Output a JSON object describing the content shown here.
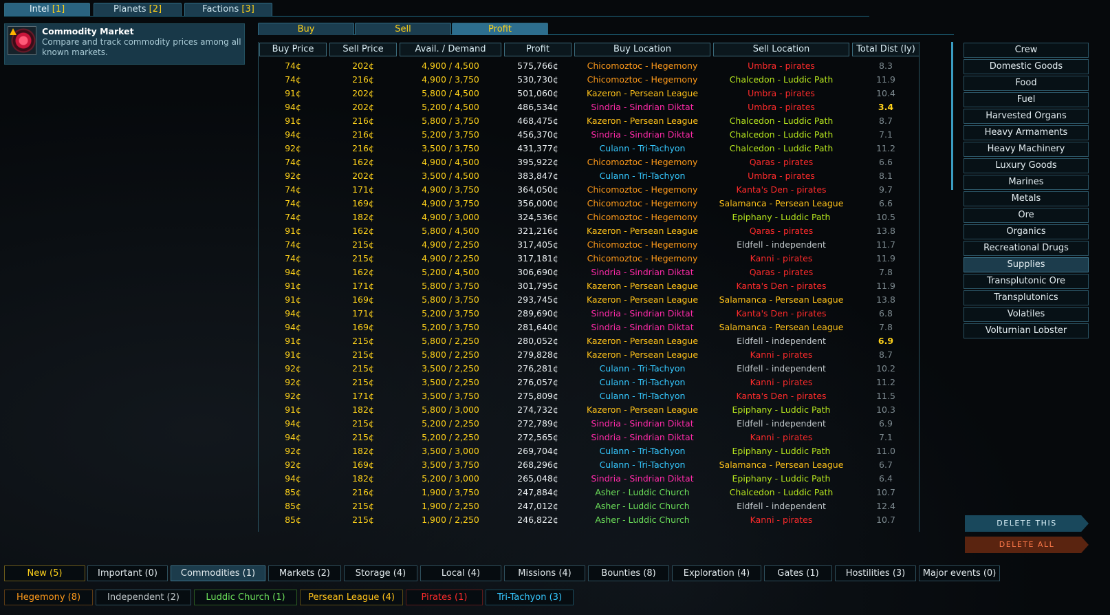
{
  "top_tabs": [
    {
      "label": "Intel",
      "count": "[1]"
    },
    {
      "label": "Planets",
      "count": "[2]"
    },
    {
      "label": "Factions",
      "count": "[3]"
    }
  ],
  "intel": {
    "title": "Commodity Market",
    "description": "Compare and track commodity prices among all known markets."
  },
  "sub_tabs": [
    "Buy",
    "Sell",
    "Profit"
  ],
  "columns": [
    "Buy Price",
    "Sell Price",
    "Avail. / Demand",
    "Profit",
    "Buy Location",
    "Sell Location",
    "Total Dist (ly)"
  ],
  "rows": [
    {
      "buy": "74¢",
      "sell": "202¢",
      "avail": "4,900 / 4,500",
      "profit": "575,766¢",
      "buy_loc": "Chicomoztoc - Hegemony",
      "buy_fac": "hegemony",
      "sell_loc": "Umbra - pirates",
      "sell_fac": "pirates",
      "dist": "8.3"
    },
    {
      "buy": "74¢",
      "sell": "216¢",
      "avail": "4,900 / 3,750",
      "profit": "530,730¢",
      "buy_loc": "Chicomoztoc - Hegemony",
      "buy_fac": "hegemony",
      "sell_loc": "Chalcedon - Luddic Path",
      "sell_fac": "luddic-path",
      "dist": "11.9"
    },
    {
      "buy": "91¢",
      "sell": "202¢",
      "avail": "5,800 / 4,500",
      "profit": "501,060¢",
      "buy_loc": "Kazeron - Persean League",
      "buy_fac": "persean",
      "sell_loc": "Umbra - pirates",
      "sell_fac": "pirates",
      "dist": "10.4"
    },
    {
      "buy": "94¢",
      "sell": "202¢",
      "avail": "5,200 / 4,500",
      "profit": "486,534¢",
      "buy_loc": "Sindria - Sindrian Diktat",
      "buy_fac": "sindrian",
      "sell_loc": "Umbra - pirates",
      "sell_fac": "pirates",
      "dist": "3.4",
      "hot": true
    },
    {
      "buy": "91¢",
      "sell": "216¢",
      "avail": "5,800 / 3,750",
      "profit": "468,475¢",
      "buy_loc": "Kazeron - Persean League",
      "buy_fac": "persean",
      "sell_loc": "Chalcedon - Luddic Path",
      "sell_fac": "luddic-path",
      "dist": "8.7"
    },
    {
      "buy": "94¢",
      "sell": "216¢",
      "avail": "5,200 / 3,750",
      "profit": "456,370¢",
      "buy_loc": "Sindria - Sindrian Diktat",
      "buy_fac": "sindrian",
      "sell_loc": "Chalcedon - Luddic Path",
      "sell_fac": "luddic-path",
      "dist": "7.1"
    },
    {
      "buy": "92¢",
      "sell": "216¢",
      "avail": "3,500 / 3,750",
      "profit": "431,377¢",
      "buy_loc": "Culann - Tri-Tachyon",
      "buy_fac": "tritachyon",
      "sell_loc": "Chalcedon - Luddic Path",
      "sell_fac": "luddic-path",
      "dist": "11.2"
    },
    {
      "buy": "74¢",
      "sell": "162¢",
      "avail": "4,900 / 4,500",
      "profit": "395,922¢",
      "buy_loc": "Chicomoztoc - Hegemony",
      "buy_fac": "hegemony",
      "sell_loc": "Qaras - pirates",
      "sell_fac": "pirates",
      "dist": "6.6"
    },
    {
      "buy": "92¢",
      "sell": "202¢",
      "avail": "3,500 / 4,500",
      "profit": "383,847¢",
      "buy_loc": "Culann - Tri-Tachyon",
      "buy_fac": "tritachyon",
      "sell_loc": "Umbra - pirates",
      "sell_fac": "pirates",
      "dist": "8.1"
    },
    {
      "buy": "74¢",
      "sell": "171¢",
      "avail": "4,900 / 3,750",
      "profit": "364,050¢",
      "buy_loc": "Chicomoztoc - Hegemony",
      "buy_fac": "hegemony",
      "sell_loc": "Kanta's Den - pirates",
      "sell_fac": "pirates",
      "dist": "9.7"
    },
    {
      "buy": "74¢",
      "sell": "169¢",
      "avail": "4,900 / 3,750",
      "profit": "356,000¢",
      "buy_loc": "Chicomoztoc - Hegemony",
      "buy_fac": "hegemony",
      "sell_loc": "Salamanca - Persean League",
      "sell_fac": "persean",
      "dist": "6.6"
    },
    {
      "buy": "74¢",
      "sell": "182¢",
      "avail": "4,900 / 3,000",
      "profit": "324,536¢",
      "buy_loc": "Chicomoztoc - Hegemony",
      "buy_fac": "hegemony",
      "sell_loc": "Epiphany - Luddic Path",
      "sell_fac": "luddic-path",
      "dist": "10.5"
    },
    {
      "buy": "91¢",
      "sell": "162¢",
      "avail": "5,800 / 4,500",
      "profit": "321,216¢",
      "buy_loc": "Kazeron - Persean League",
      "buy_fac": "persean",
      "sell_loc": "Qaras - pirates",
      "sell_fac": "pirates",
      "dist": "13.8"
    },
    {
      "buy": "74¢",
      "sell": "215¢",
      "avail": "4,900 / 2,250",
      "profit": "317,405¢",
      "buy_loc": "Chicomoztoc - Hegemony",
      "buy_fac": "hegemony",
      "sell_loc": "Eldfell - independent",
      "sell_fac": "independent",
      "dist": "11.7"
    },
    {
      "buy": "74¢",
      "sell": "215¢",
      "avail": "4,900 / 2,250",
      "profit": "317,181¢",
      "buy_loc": "Chicomoztoc - Hegemony",
      "buy_fac": "hegemony",
      "sell_loc": "Kanni - pirates",
      "sell_fac": "pirates",
      "dist": "11.9"
    },
    {
      "buy": "94¢",
      "sell": "162¢",
      "avail": "5,200 / 4,500",
      "profit": "306,690¢",
      "buy_loc": "Sindria - Sindrian Diktat",
      "buy_fac": "sindrian",
      "sell_loc": "Qaras - pirates",
      "sell_fac": "pirates",
      "dist": "7.8"
    },
    {
      "buy": "91¢",
      "sell": "171¢",
      "avail": "5,800 / 3,750",
      "profit": "301,795¢",
      "buy_loc": "Kazeron - Persean League",
      "buy_fac": "persean",
      "sell_loc": "Kanta's Den - pirates",
      "sell_fac": "pirates",
      "dist": "11.9"
    },
    {
      "buy": "91¢",
      "sell": "169¢",
      "avail": "5,800 / 3,750",
      "profit": "293,745¢",
      "buy_loc": "Kazeron - Persean League",
      "buy_fac": "persean",
      "sell_loc": "Salamanca - Persean League",
      "sell_fac": "persean",
      "dist": "13.8"
    },
    {
      "buy": "94¢",
      "sell": "171¢",
      "avail": "5,200 / 3,750",
      "profit": "289,690¢",
      "buy_loc": "Sindria - Sindrian Diktat",
      "buy_fac": "sindrian",
      "sell_loc": "Kanta's Den - pirates",
      "sell_fac": "pirates",
      "dist": "6.8"
    },
    {
      "buy": "94¢",
      "sell": "169¢",
      "avail": "5,200 / 3,750",
      "profit": "281,640¢",
      "buy_loc": "Sindria - Sindrian Diktat",
      "buy_fac": "sindrian",
      "sell_loc": "Salamanca - Persean League",
      "sell_fac": "persean",
      "dist": "7.8"
    },
    {
      "buy": "91¢",
      "sell": "215¢",
      "avail": "5,800 / 2,250",
      "profit": "280,052¢",
      "buy_loc": "Kazeron - Persean League",
      "buy_fac": "persean",
      "sell_loc": "Eldfell - independent",
      "sell_fac": "independent",
      "dist": "6.9",
      "hot": true
    },
    {
      "buy": "91¢",
      "sell": "215¢",
      "avail": "5,800 / 2,250",
      "profit": "279,828¢",
      "buy_loc": "Kazeron - Persean League",
      "buy_fac": "persean",
      "sell_loc": "Kanni - pirates",
      "sell_fac": "pirates",
      "dist": "8.7"
    },
    {
      "buy": "92¢",
      "sell": "215¢",
      "avail": "3,500 / 2,250",
      "profit": "276,281¢",
      "buy_loc": "Culann - Tri-Tachyon",
      "buy_fac": "tritachyon",
      "sell_loc": "Eldfell - independent",
      "sell_fac": "independent",
      "dist": "10.2"
    },
    {
      "buy": "92¢",
      "sell": "215¢",
      "avail": "3,500 / 2,250",
      "profit": "276,057¢",
      "buy_loc": "Culann - Tri-Tachyon",
      "buy_fac": "tritachyon",
      "sell_loc": "Kanni - pirates",
      "sell_fac": "pirates",
      "dist": "11.2"
    },
    {
      "buy": "92¢",
      "sell": "171¢",
      "avail": "3,500 / 3,750",
      "profit": "275,809¢",
      "buy_loc": "Culann - Tri-Tachyon",
      "buy_fac": "tritachyon",
      "sell_loc": "Kanta's Den - pirates",
      "sell_fac": "pirates",
      "dist": "11.5"
    },
    {
      "buy": "91¢",
      "sell": "182¢",
      "avail": "5,800 / 3,000",
      "profit": "274,732¢",
      "buy_loc": "Kazeron - Persean League",
      "buy_fac": "persean",
      "sell_loc": "Epiphany - Luddic Path",
      "sell_fac": "luddic-path",
      "dist": "10.3"
    },
    {
      "buy": "94¢",
      "sell": "215¢",
      "avail": "5,200 / 2,250",
      "profit": "272,789¢",
      "buy_loc": "Sindria - Sindrian Diktat",
      "buy_fac": "sindrian",
      "sell_loc": "Eldfell - independent",
      "sell_fac": "independent",
      "dist": "6.9"
    },
    {
      "buy": "94¢",
      "sell": "215¢",
      "avail": "5,200 / 2,250",
      "profit": "272,565¢",
      "buy_loc": "Sindria - Sindrian Diktat",
      "buy_fac": "sindrian",
      "sell_loc": "Kanni - pirates",
      "sell_fac": "pirates",
      "dist": "7.1"
    },
    {
      "buy": "92¢",
      "sell": "182¢",
      "avail": "3,500 / 3,000",
      "profit": "269,704¢",
      "buy_loc": "Culann - Tri-Tachyon",
      "buy_fac": "tritachyon",
      "sell_loc": "Epiphany - Luddic Path",
      "sell_fac": "luddic-path",
      "dist": "11.0"
    },
    {
      "buy": "92¢",
      "sell": "169¢",
      "avail": "3,500 / 3,750",
      "profit": "268,296¢",
      "buy_loc": "Culann - Tri-Tachyon",
      "buy_fac": "tritachyon",
      "sell_loc": "Salamanca - Persean League",
      "sell_fac": "persean",
      "dist": "6.7"
    },
    {
      "buy": "94¢",
      "sell": "182¢",
      "avail": "5,200 / 3,000",
      "profit": "265,048¢",
      "buy_loc": "Sindria - Sindrian Diktat",
      "buy_fac": "sindrian",
      "sell_loc": "Epiphany - Luddic Path",
      "sell_fac": "luddic-path",
      "dist": "6.4"
    },
    {
      "buy": "85¢",
      "sell": "216¢",
      "avail": "1,900 / 3,750",
      "profit": "247,884¢",
      "buy_loc": "Asher - Luddic Church",
      "buy_fac": "luddic-church",
      "sell_loc": "Chalcedon - Luddic Path",
      "sell_fac": "luddic-path",
      "dist": "10.7"
    },
    {
      "buy": "85¢",
      "sell": "215¢",
      "avail": "1,900 / 2,250",
      "profit": "247,012¢",
      "buy_loc": "Asher - Luddic Church",
      "buy_fac": "luddic-church",
      "sell_loc": "Eldfell - independent",
      "sell_fac": "independent",
      "dist": "12.4"
    },
    {
      "buy": "85¢",
      "sell": "215¢",
      "avail": "1,900 / 2,250",
      "profit": "246,822¢",
      "buy_loc": "Asher - Luddic Church",
      "buy_fac": "luddic-church",
      "sell_loc": "Kanni - pirates",
      "sell_fac": "pirates",
      "dist": "10.7"
    }
  ],
  "commodities": [
    "Crew",
    "Domestic Goods",
    "Food",
    "Fuel",
    "Harvested Organs",
    "Heavy Armaments",
    "Heavy Machinery",
    "Luxury Goods",
    "Marines",
    "Metals",
    "Ore",
    "Organics",
    "Recreational Drugs",
    "Supplies",
    "Transplutonic Ore",
    "Transplutonics",
    "Volatiles",
    "Volturnian Lobster"
  ],
  "selected_commodity": "Supplies",
  "actions": {
    "delete_this": "DELETE THIS",
    "delete_all": "DELETE ALL"
  },
  "filters_row1": [
    "New (5)",
    "Important (0)",
    "Commodities (1)",
    "Markets (2)",
    "Storage (4)",
    "Local (4)",
    "Missions (4)",
    "Bounties (8)",
    "Exploration (4)",
    "Gates (1)",
    "Hostilities (3)",
    "Major events (0)"
  ],
  "filters_row2": [
    "Hegemony (8)",
    "Independent (2)",
    "Luddic Church (1)",
    "Persean League (4)",
    "Pirates (1)",
    "Tri-Tachyon (3)"
  ],
  "colors": {
    "yellow": "#ffd21a",
    "hegemony": "#ff9a1a",
    "persean": "#ffc21a",
    "sindrian": "#ff2aa8",
    "tritachyon": "#35c8ff",
    "pirates": "#ff2b2b",
    "luddic_path": "#b7e61e",
    "luddic_church": "#6ce05a",
    "independent": "#bfc6c9",
    "panel": "#183848"
  }
}
